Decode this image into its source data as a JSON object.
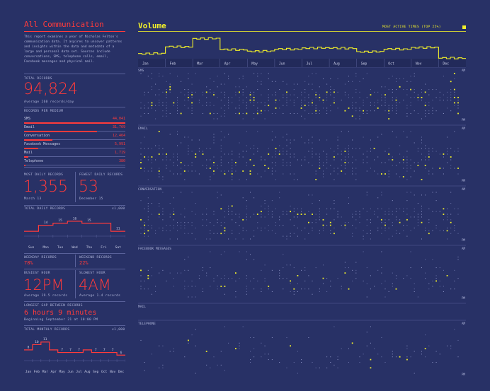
{
  "left": {
    "title": "All Communication",
    "intro": "This report examines a year of Nicholas Felton's communication data. It aspires to uncover patterns and insights within the data and metadata of a large and personal data set. Sources include conversations, SMS, telephone calls, email, Facebook messages and physical mail.",
    "total_records_label": "TOTAL RECORDS",
    "total_records_value": "94,824",
    "total_records_sub": "Average 260 records/day",
    "per_medium_label": "RECORDS PER MEDIUM",
    "mediums": [
      {
        "name": "SMS",
        "value": "44,041",
        "fraction": 1.0
      },
      {
        "name": "Email",
        "value": "31,769",
        "fraction": 0.72
      },
      {
        "name": "Conversation",
        "value": "12,464",
        "fraction": 0.28
      },
      {
        "name": "Facebook Messages",
        "value": "5,991",
        "fraction": 0.14
      },
      {
        "name": "Mail",
        "value": "1,719",
        "fraction": 0.04
      },
      {
        "name": "Telephone",
        "value": "380",
        "fraction": 0.01
      }
    ],
    "most_daily_label": "MOST DAILY RECORDS",
    "most_daily_value": "1,355",
    "most_daily_date": "March 13",
    "fewest_daily_label": "FEWEST DAILY RECORDS",
    "fewest_daily_value": "53",
    "fewest_daily_date": "December 15",
    "total_daily_label": "TOTAL DAILY RECORDS",
    "total_daily_unit": "x1,000",
    "weekday_label": "WEEKDAY RECORDS",
    "weekday_value": "78%",
    "weekend_label": "WEEKEND RECORDS",
    "weekend_value": "22%",
    "busiest_label": "BUSIEST HOUR",
    "busiest_value": "12PM",
    "busiest_sub": "Average 19.5 records",
    "slowest_label": "SLOWEST HOUR",
    "slowest_value": "4AM",
    "slowest_sub": "Average 1.4 records",
    "gap_label": "LONGEST GAP BETWEEN RECORDS",
    "gap_value": "6 hours 9 minutes",
    "gap_sub": "Beginning September 21 at 10:00 PM",
    "monthly_label": "TOTAL MONTHLY RECORDS",
    "monthly_unit": "x1,000"
  },
  "right": {
    "title": "Volume",
    "legend_label": "MOST ACTIVE TIMES (TOP 25%)",
    "months": [
      "Jan",
      "Feb",
      "Mar",
      "Apr",
      "May",
      "Jun",
      "Jul",
      "Aug",
      "Sep",
      "Oct",
      "Nov",
      "Dec"
    ],
    "panels": [
      {
        "name": "SMS",
        "am": "AM",
        "pm": "PM"
      },
      {
        "name": "EMAIL",
        "am": "AM",
        "pm": "PM"
      },
      {
        "name": "CONVERSATION",
        "am": "AM",
        "pm": "PM"
      },
      {
        "name": "FACEBOOK MESSAGES",
        "am": "AM",
        "pm": "PM"
      },
      {
        "name": "MAIL",
        "am": "",
        "pm": ""
      },
      {
        "name": "TELEPHONE",
        "am": "AM",
        "pm": "PM"
      }
    ]
  },
  "chart_data": [
    {
      "type": "line",
      "title": "Volume",
      "x": [
        "Jan",
        "Feb",
        "Mar",
        "Apr",
        "May",
        "Jun",
        "Jul",
        "Aug",
        "Sep",
        "Oct",
        "Nov",
        "Dec"
      ],
      "series": [
        {
          "values": [
            6.0,
            7.4,
            9.2,
            6.8,
            6.5,
            6.9,
            7.2,
            7.1,
            6.4,
            6.9,
            7.3,
            5.0
          ]
        }
      ],
      "color": "#f2f02a"
    },
    {
      "type": "line",
      "title": "TOTAL DAILY RECORDS",
      "categories": [
        "Sun",
        "Mon",
        "Tue",
        "Wed",
        "Thu",
        "Fri",
        "Sat"
      ],
      "values": [
        11,
        14,
        15,
        16,
        15,
        15,
        11
      ],
      "labels": [
        "",
        "14",
        "15",
        "16",
        "15",
        "",
        "11"
      ],
      "color": "#ff3b3b"
    },
    {
      "type": "line",
      "title": "TOTAL MONTHLY RECORDS",
      "categories": [
        "Jan",
        "Feb",
        "Mar",
        "Apr",
        "May",
        "Jun",
        "Jul",
        "Aug",
        "Sep",
        "Oct",
        "Nov",
        "Dec"
      ],
      "values": [
        8,
        10,
        11,
        8,
        7,
        7,
        7,
        8,
        7,
        7,
        7,
        6
      ],
      "labels": [
        "8",
        "10",
        "11",
        "",
        "7",
        "7",
        "7",
        "",
        "7",
        "7",
        "7",
        "6"
      ],
      "color": "#ff3b3b"
    }
  ]
}
